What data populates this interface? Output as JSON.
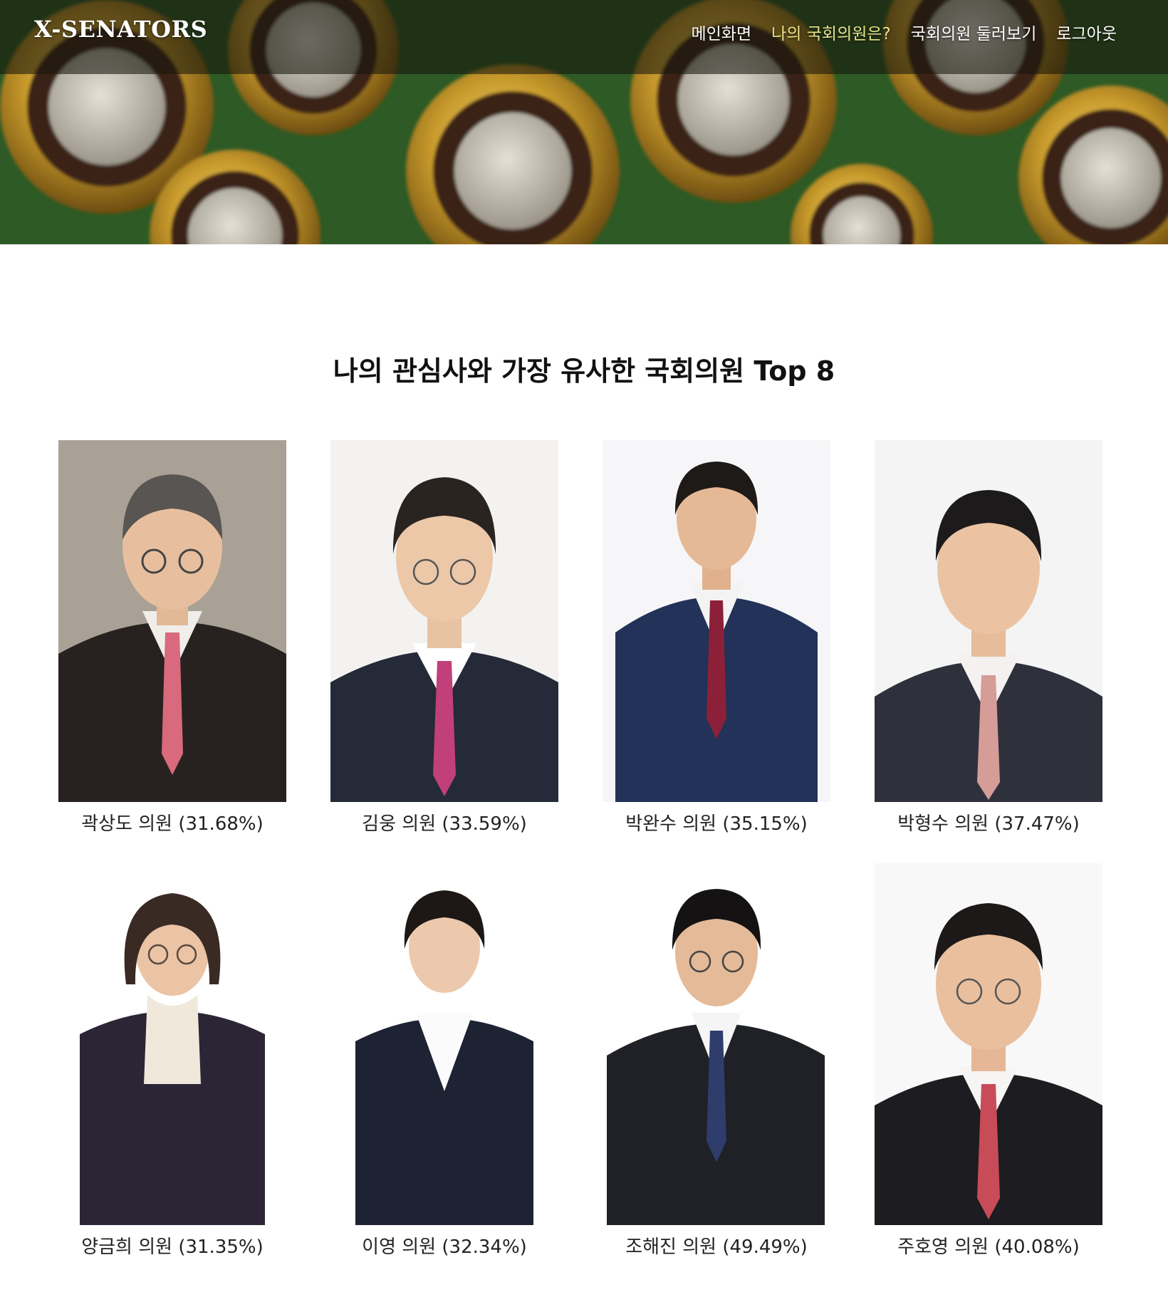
{
  "brand": {
    "name": "X-SENATORS"
  },
  "nav": {
    "items": [
      {
        "label": "메인화면",
        "active": false
      },
      {
        "label": "나의 국회의원은?",
        "active": true
      },
      {
        "label": "국회의원 둘러보기",
        "active": false
      },
      {
        "label": "로그아웃",
        "active": false
      }
    ],
    "active_color": "#e9e38a"
  },
  "main": {
    "title": "나의 관심사와 가장 유사한 국회의원 Top 8",
    "senators": [
      {
        "label": "곽상도 의원 (31.68%)"
      },
      {
        "label": "김웅 의원 (33.59%)"
      },
      {
        "label": "박완수 의원 (35.15%)"
      },
      {
        "label": "박형수 의원 (37.47%)"
      },
      {
        "label": "양금희 의원 (31.35%)"
      },
      {
        "label": "이영 의원 (32.34%)"
      },
      {
        "label": "조해진 의원 (49.49%)"
      },
      {
        "label": "주호영 의원 (40.08%)"
      }
    ]
  }
}
